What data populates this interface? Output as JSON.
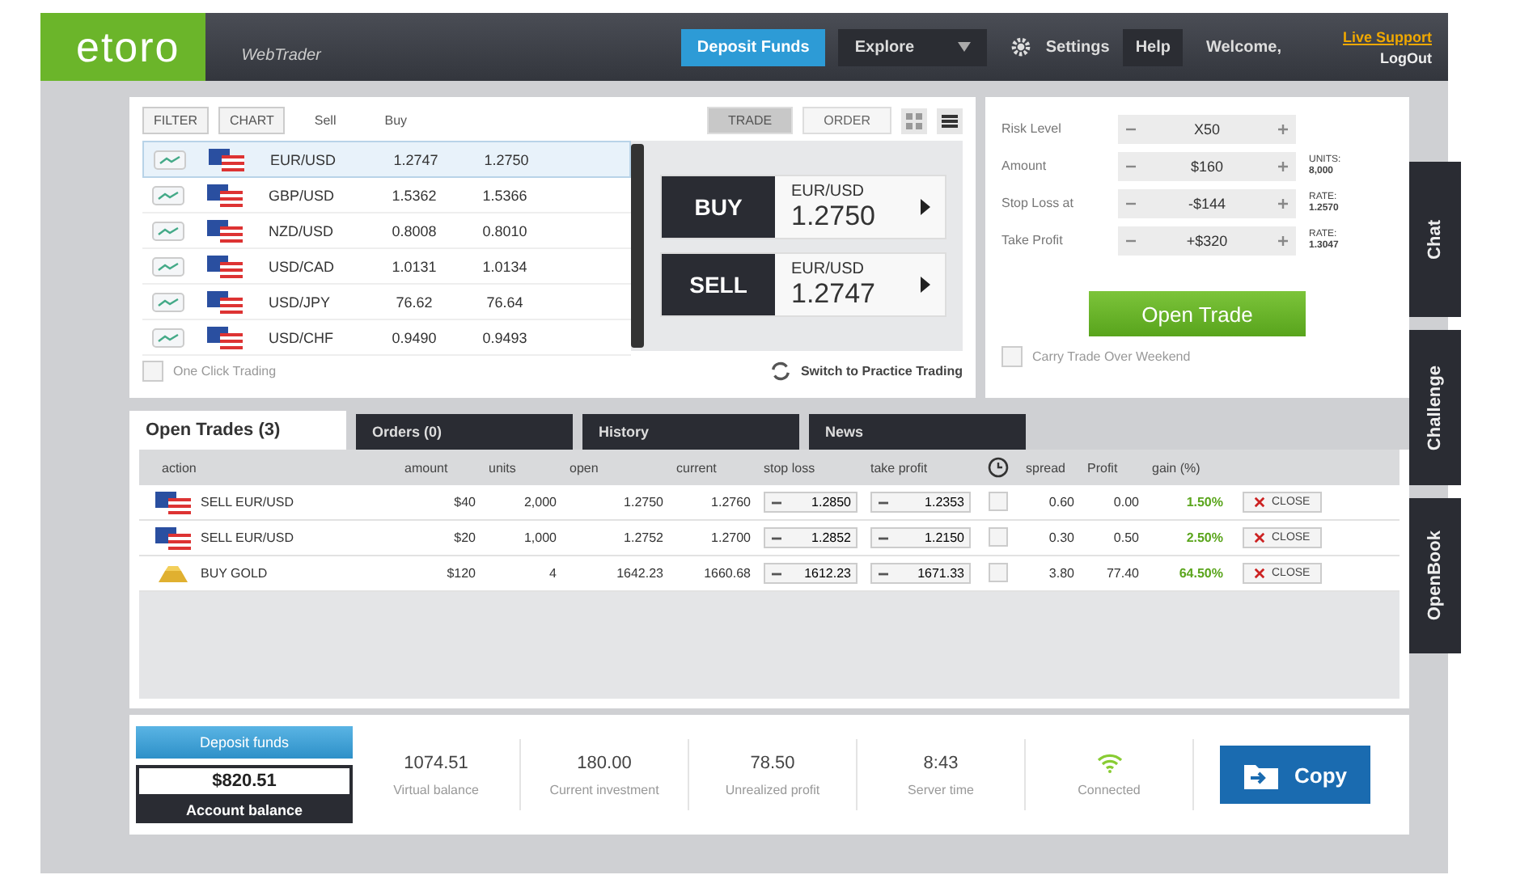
{
  "header": {
    "logo": "etoro",
    "subtitle": "WebTrader",
    "deposit": "Deposit Funds",
    "explore": "Explore",
    "settings": "Settings",
    "help": "Help",
    "welcome": "Welcome,",
    "live_support": "Live Support",
    "logout": "LogOut"
  },
  "market": {
    "filter": "FILTER",
    "chart": "CHART",
    "sell_header": "Sell",
    "buy_header": "Buy",
    "modes": [
      {
        "label": "TRADE",
        "selected": true
      },
      {
        "label": "ORDER",
        "selected": false
      }
    ],
    "instruments": [
      {
        "symbol": "EUR/USD",
        "sell": "1.2747",
        "buy": "1.2750",
        "selected": true
      },
      {
        "symbol": "GBP/USD",
        "sell": "1.5362",
        "buy": "1.5366",
        "selected": false
      },
      {
        "symbol": "NZD/USD",
        "sell": "0.8008",
        "buy": "0.8010",
        "selected": false
      },
      {
        "symbol": "USD/CAD",
        "sell": "1.0131",
        "buy": "1.0134",
        "selected": false
      },
      {
        "symbol": "USD/JPY",
        "sell": "76.62",
        "buy": "76.64",
        "selected": false
      },
      {
        "symbol": "USD/CHF",
        "sell": "0.9490",
        "buy": "0.9493",
        "selected": false
      }
    ],
    "buy": {
      "label": "BUY",
      "symbol": "EUR/USD",
      "price": "1.2750"
    },
    "sell": {
      "label": "SELL",
      "symbol": "EUR/USD",
      "price": "1.2747"
    },
    "one_click": {
      "label": "One Click Trading",
      "checked": false
    },
    "switch_practice": "Switch to Practice Trading"
  },
  "order_form": {
    "rows": [
      {
        "label": "Risk Level",
        "value": "X50"
      },
      {
        "label": "Amount",
        "value": "$160",
        "note_label": "UNITS:",
        "note_value": "8,000"
      },
      {
        "label": "Stop Loss at",
        "value": "-$144",
        "note_label": "RATE:",
        "note_value": "1.2570"
      },
      {
        "label": "Take Profit",
        "value": "+$320",
        "note_label": "RATE:",
        "note_value": "1.3047"
      }
    ],
    "open_trade": "Open Trade",
    "carry": {
      "label": "Carry Trade Over Weekend",
      "checked": false
    }
  },
  "tabs": [
    {
      "label": "Open Trades (3)",
      "selected": true
    },
    {
      "label": "Orders (0)",
      "selected": false
    },
    {
      "label": "History",
      "selected": false
    },
    {
      "label": "News",
      "selected": false
    }
  ],
  "table": {
    "columns": [
      "action",
      "amount",
      "units",
      "open",
      "current",
      "stop loss",
      "take profit",
      "spread",
      "Profit",
      "gain (%)"
    ],
    "rows": [
      {
        "kind": "currency",
        "action": "SELL EUR/USD",
        "amount": "$40",
        "units": "2,000",
        "open": "1.2750",
        "current": "1.2760",
        "stop_loss": "1.2850",
        "take_profit": "1.2353",
        "spread": "0.60",
        "profit": "0.00",
        "gain": "1.50%",
        "close": "CLOSE",
        "checked": false
      },
      {
        "kind": "currency",
        "action": "SELL EUR/USD",
        "amount": "$20",
        "units": "1,000",
        "open": "1.2752",
        "current": "1.2700",
        "stop_loss": "1.2852",
        "take_profit": "1.2150",
        "spread": "0.30",
        "profit": "0.50",
        "gain": "2.50%",
        "close": "CLOSE",
        "checked": false
      },
      {
        "kind": "gold",
        "action": "BUY GOLD",
        "amount": "$120",
        "units": "4",
        "open": "1642.23",
        "current": "1660.68",
        "stop_loss": "1612.23",
        "take_profit": "1671.33",
        "spread": "3.80",
        "profit": "77.40",
        "gain": "64.50%",
        "close": "CLOSE",
        "checked": false
      }
    ]
  },
  "footer": {
    "deposit": "Deposit funds",
    "balance": "$820.51",
    "balance_label": "Account balance",
    "stats": [
      {
        "value": "1074.51",
        "label": "Virtual balance"
      },
      {
        "value": "180.00",
        "label": "Current investment"
      },
      {
        "value": "78.50",
        "label": "Unrealized profit"
      },
      {
        "value": "8:43",
        "label": "Server time"
      }
    ],
    "connected": "Connected",
    "copy": "Copy"
  },
  "side_tabs": [
    {
      "label": "Chat"
    },
    {
      "label": "Challenge"
    },
    {
      "label": "OpenBook"
    }
  ]
}
